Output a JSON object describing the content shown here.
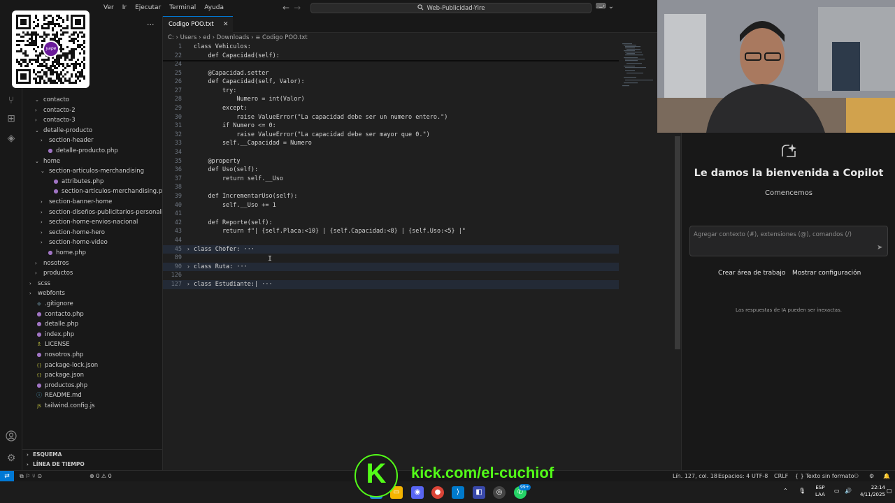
{
  "titlebar": {
    "menus": [
      "Ver",
      "Ir",
      "Ejecutar",
      "Terminal",
      "Ayuda"
    ],
    "search_text": "Web-Publicidad-Yire"
  },
  "sidebar": {
    "tree": [
      {
        "label": "contacto",
        "indent": 1,
        "kind": "folder-open",
        "chev": "⌄"
      },
      {
        "label": "contacto-2",
        "indent": 1,
        "kind": "folder",
        "chev": "›"
      },
      {
        "label": "contacto-3",
        "indent": 1,
        "kind": "folder",
        "chev": "›"
      },
      {
        "label": "detalle-producto",
        "indent": 1,
        "kind": "folder-open",
        "chev": "⌄"
      },
      {
        "label": "section-header",
        "indent": 2,
        "kind": "folder",
        "chev": "›"
      },
      {
        "label": "detalle-producto.php",
        "indent": 2,
        "kind": "php",
        "chev": ""
      },
      {
        "label": "home",
        "indent": 1,
        "kind": "folder-open",
        "chev": "⌄"
      },
      {
        "label": "section-articulos-merchandising",
        "indent": 2,
        "kind": "folder-open",
        "chev": "⌄"
      },
      {
        "label": "attributes.php",
        "indent": 3,
        "kind": "php",
        "chev": ""
      },
      {
        "label": "section-articulos-merchandising.php",
        "indent": 3,
        "kind": "php",
        "chev": ""
      },
      {
        "label": "section-banner-home",
        "indent": 2,
        "kind": "folder",
        "chev": "›"
      },
      {
        "label": "section-diseños-publicitarios-personaliza...",
        "indent": 2,
        "kind": "folder",
        "chev": "›"
      },
      {
        "label": "section-home-envios-nacional",
        "indent": 2,
        "kind": "folder",
        "chev": "›"
      },
      {
        "label": "section-home-hero",
        "indent": 2,
        "kind": "folder",
        "chev": "›"
      },
      {
        "label": "section-home-video",
        "indent": 2,
        "kind": "folder",
        "chev": "›"
      },
      {
        "label": "home.php",
        "indent": 2,
        "kind": "php",
        "chev": ""
      },
      {
        "label": "nosotros",
        "indent": 1,
        "kind": "folder",
        "chev": "›"
      },
      {
        "label": "productos",
        "indent": 1,
        "kind": "folder",
        "chev": "›"
      },
      {
        "label": "scss",
        "indent": 0,
        "kind": "folder",
        "chev": "›"
      },
      {
        "label": "webfonts",
        "indent": 0,
        "kind": "folder",
        "chev": "›"
      },
      {
        "label": ".gitignore",
        "indent": 0,
        "kind": "git",
        "chev": ""
      },
      {
        "label": "contacto.php",
        "indent": 0,
        "kind": "php",
        "chev": ""
      },
      {
        "label": "detalle.php",
        "indent": 0,
        "kind": "php",
        "chev": ""
      },
      {
        "label": "index.php",
        "indent": 0,
        "kind": "php",
        "chev": ""
      },
      {
        "label": "LICENSE",
        "indent": 0,
        "kind": "license",
        "chev": ""
      },
      {
        "label": "nosotros.php",
        "indent": 0,
        "kind": "php",
        "chev": ""
      },
      {
        "label": "package-lock.json",
        "indent": 0,
        "kind": "json",
        "chev": ""
      },
      {
        "label": "package.json",
        "indent": 0,
        "kind": "json",
        "chev": ""
      },
      {
        "label": "productos.php",
        "indent": 0,
        "kind": "php",
        "chev": ""
      },
      {
        "label": "README.md",
        "indent": 0,
        "kind": "md",
        "chev": ""
      },
      {
        "label": "tailwind.config.js",
        "indent": 0,
        "kind": "js",
        "chev": ""
      }
    ],
    "sections": [
      "ESQUEMA",
      "LÍNEA DE TIEMPO"
    ]
  },
  "tab": {
    "label": "Codigo POO.txt",
    "close": "✕"
  },
  "breadcrumb": [
    "C:",
    "Users",
    "ed",
    "Downloads",
    "Codigo POO.txt"
  ],
  "editor": {
    "sticky": [
      {
        "n": "1",
        "code": "class Vehiculos:"
      },
      {
        "n": "22",
        "code": "    def Capacidad(self):"
      }
    ],
    "lines": [
      {
        "n": "24",
        "code": ""
      },
      {
        "n": "25",
        "code": "    @Capacidad.setter"
      },
      {
        "n": "26",
        "code": "    def Capacidad(self, Valor):"
      },
      {
        "n": "27",
        "code": "        try:"
      },
      {
        "n": "28",
        "code": "            Numero = int(Valor)"
      },
      {
        "n": "29",
        "code": "        except:"
      },
      {
        "n": "30",
        "code": "            raise ValueError(\"La capacidad debe ser un numero entero.\")"
      },
      {
        "n": "31",
        "code": "        if Numero <= 0:"
      },
      {
        "n": "32",
        "code": "            raise ValueError(\"La capacidad debe ser mayor que 0.\")"
      },
      {
        "n": "33",
        "code": "        self.__Capacidad = Numero"
      },
      {
        "n": "34",
        "code": ""
      },
      {
        "n": "35",
        "code": "    @property"
      },
      {
        "n": "36",
        "code": "    def Uso(self):"
      },
      {
        "n": "37",
        "code": "        return self.__Uso"
      },
      {
        "n": "38",
        "code": ""
      },
      {
        "n": "39",
        "code": "    def IncrementarUso(self):"
      },
      {
        "n": "40",
        "code": "        self.__Uso += 1"
      },
      {
        "n": "41",
        "code": ""
      },
      {
        "n": "42",
        "code": "    def Reporte(self):"
      },
      {
        "n": "43",
        "code": "        return f\"| {self.Placa:<10} | {self.Capacidad:<8} | {self.Uso:<5} |\""
      },
      {
        "n": "44",
        "code": ""
      },
      {
        "n": "45",
        "code": "class Chofer: ···",
        "fold": true
      },
      {
        "n": "89",
        "code": ""
      },
      {
        "n": "90",
        "code": "class Ruta: ···",
        "fold": true
      },
      {
        "n": "126",
        "code": ""
      },
      {
        "n": "127",
        "code": "class Estudiante:| ···",
        "fold": true
      }
    ]
  },
  "copilot": {
    "title": "Le damos la bienvenida a Copilot",
    "subtitle": "Comencemos",
    "input_placeholder": "Agregar contexto (#), extensiones (@), comandos (/)",
    "btn_workspace": "Crear área de trabajo",
    "btn_config": "Mostrar configuración",
    "note": "Las respuestas de IA pueden ser inexactas."
  },
  "statusbar": {
    "problems": "⊗ 0 ⚠ 0",
    "position": "Lín. 127, col. 18",
    "spaces": "Espacios: 4",
    "encoding": "UTF-8",
    "eol": "CRLF",
    "language": "{ } Texto sin formato"
  },
  "overlay": {
    "kick_letter": "K",
    "kick_url": "kick.com/el-cuchiof",
    "qr_brand": "yape"
  },
  "taskbar": {
    "lang_top": "ESP",
    "lang_bottom": "LAA",
    "time": "22:14",
    "date": "4/11/2025",
    "badge": "99+"
  }
}
